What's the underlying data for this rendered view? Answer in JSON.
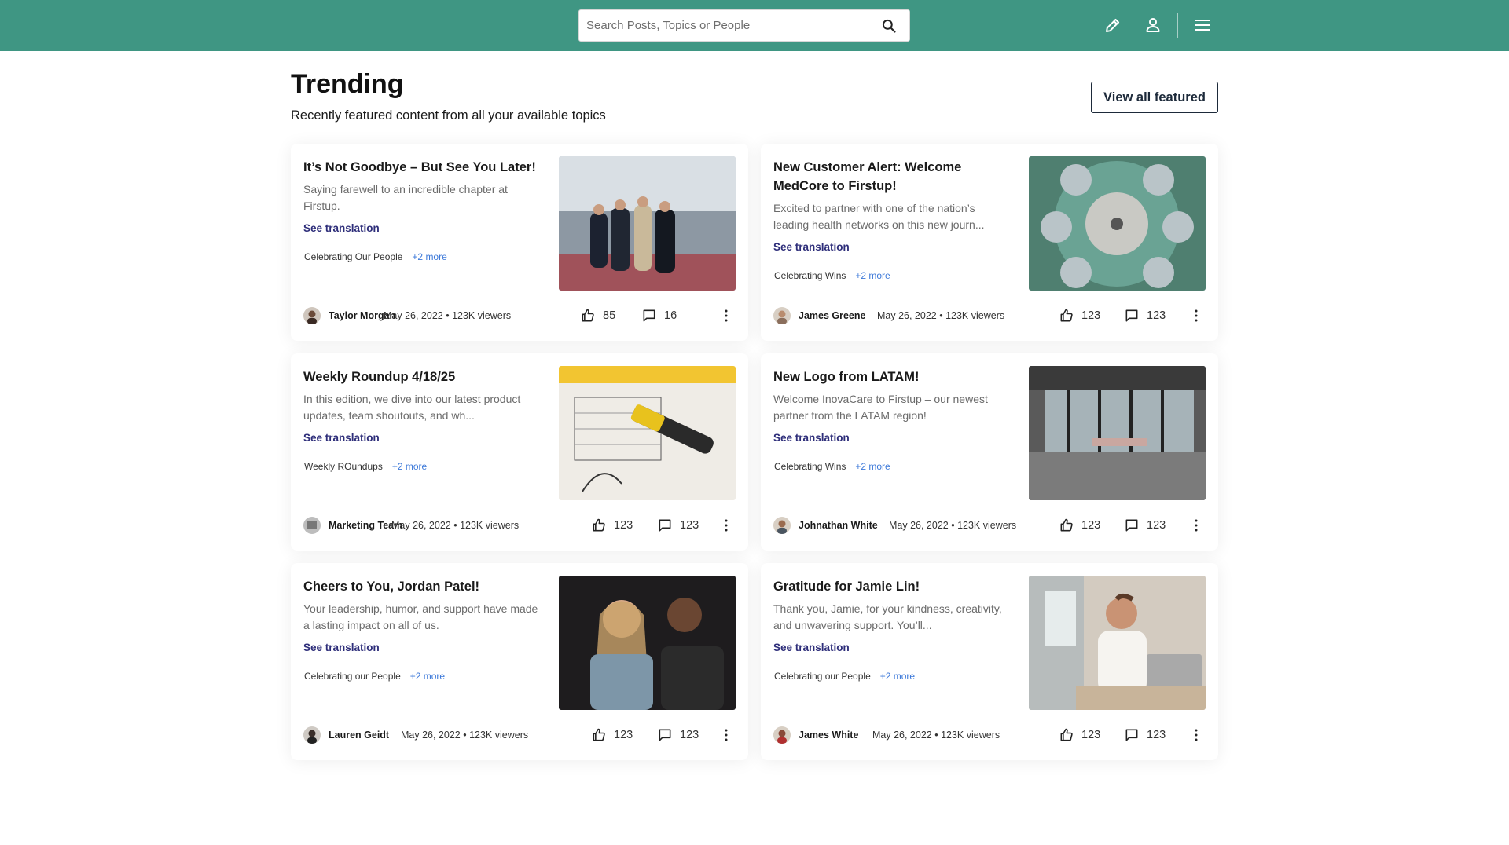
{
  "header": {
    "search_placeholder": "Search Posts, Topics or People",
    "brand_color": "#3f9683"
  },
  "page": {
    "title": "Trending",
    "subtitle": "Recently featured content from all your available topics",
    "view_all_label": "View all featured"
  },
  "posts": [
    {
      "title": "It’s Not Goodbye – But See You Later!",
      "description": "Saying farewell to an incredible chapter at Firstup.",
      "translation_label": "See translation",
      "tag": "Celebrating Our People",
      "more": "+2 more",
      "author": "Taylor Morgan",
      "meta": "May 26, 2022 • 123K viewers",
      "likes": "85",
      "comments": "16"
    },
    {
      "title": "New Customer Alert: Welcome MedCore to Firstup!",
      "description": "Excited to partner with one of the nation’s leading health networks on this new journ...",
      "translation_label": "See translation",
      "tag": "Celebrating Wins",
      "more": "+2 more",
      "author": "James Greene",
      "meta": "May 26, 2022 • 123K viewers",
      "likes": "123",
      "comments": "123"
    },
    {
      "title": "Weekly Roundup 4/18/25",
      "description": "In this edition, we dive into our latest product updates, team shoutouts, and wh...",
      "translation_label": "See translation",
      "tag": "Weekly ROundups",
      "more": "+2 more",
      "author": "Marketing Team",
      "meta": "May 26, 2022 • 123K viewers",
      "likes": "123",
      "comments": "123"
    },
    {
      "title": "New Logo from LATAM!",
      "description": "Welcome InovaCare to Firstup – our newest partner from the LATAM region!",
      "translation_label": "See translation",
      "tag": "Celebrating Wins",
      "more": "+2 more",
      "author": "Johnathan White",
      "meta": "May 26, 2022 • 123K viewers",
      "likes": "123",
      "comments": "123"
    },
    {
      "title": "Cheers to You, Jordan Patel!",
      "description": "Your leadership, humor, and support have made a lasting impact on all of us.",
      "translation_label": "See translation",
      "tag": "Celebrating our People",
      "more": "+2 more",
      "author": "Lauren Geidt",
      "meta": "May 26, 2022 • 123K viewers",
      "likes": "123",
      "comments": "123"
    },
    {
      "title": "Gratitude for Jamie Lin!",
      "description": "Thank you, Jamie, for your kindness, creativity, and unwavering support. You’ll...",
      "translation_label": "See translation",
      "tag": "Celebrating our People",
      "more": "+2 more",
      "author": "James White",
      "meta": "May 26, 2022 • 123K viewers",
      "likes": "123",
      "comments": "123"
    }
  ]
}
